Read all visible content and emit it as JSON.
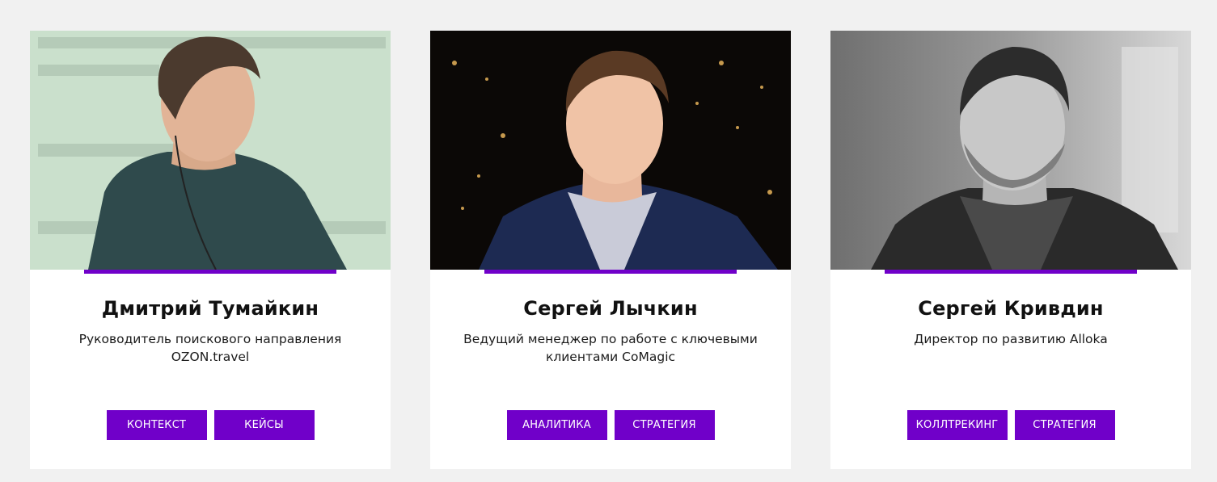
{
  "accent_color": "#7000c9",
  "speakers": [
    {
      "name": "Дмитрий Тумайкин",
      "role": "Руководитель поискового направления OZON.travel",
      "tags": [
        "КОНТЕКСТ",
        "КЕЙСЫ"
      ]
    },
    {
      "name": "Сергей Лычкин",
      "role": "Ведущий менеджер по работе с ключевыми клиентами CoMagic",
      "tags": [
        "АНАЛИТИКА",
        "СТРАТЕГИЯ"
      ]
    },
    {
      "name": "Сергей Кривдин",
      "role": "Директор по развитию Alloka",
      "tags": [
        "КОЛЛТРЕКИНГ",
        "СТРАТЕГИЯ"
      ]
    }
  ]
}
